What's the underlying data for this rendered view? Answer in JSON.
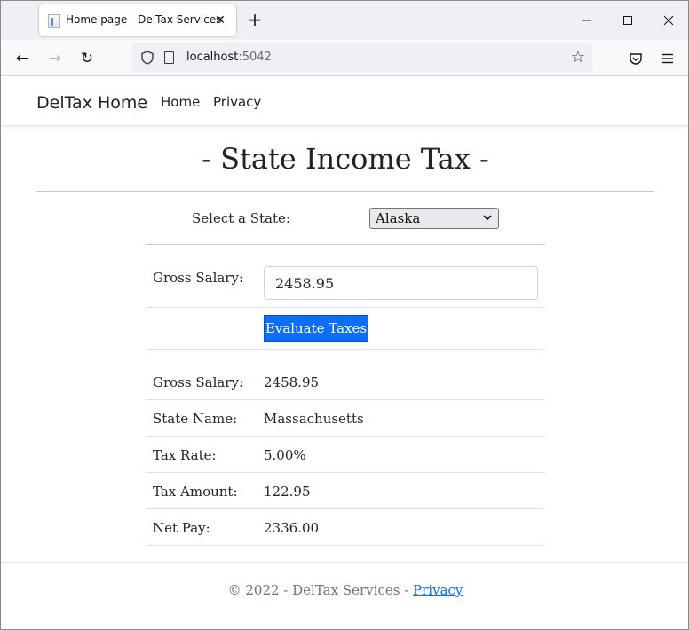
{
  "browser": {
    "tab_title": "Home page - DelTax Services",
    "url_host": "localhost",
    "url_port": ":5042"
  },
  "nav": {
    "brand": "DelTax Home",
    "links": [
      "Home",
      "Privacy"
    ]
  },
  "main": {
    "title": "- State Income Tax -",
    "state_label": "Select a State:",
    "state_selected": "Alaska",
    "gross_label": "Gross Salary:",
    "gross_value": "2458.95",
    "evaluate_label": "Evaluate Taxes"
  },
  "results": [
    {
      "label": "Gross Salary:",
      "value": "2458.95"
    },
    {
      "label": "State Name:",
      "value": "Massachusetts"
    },
    {
      "label": "Tax Rate:",
      "value": "5.00%"
    },
    {
      "label": "Tax Amount:",
      "value": "122.95"
    },
    {
      "label": "Net Pay:",
      "value": "2336.00"
    }
  ],
  "footer": {
    "text": "© 2022 - DelTax Services - ",
    "link": "Privacy"
  },
  "colors": {
    "primary_button": "#0d6efd",
    "link": "#0d6efd"
  }
}
